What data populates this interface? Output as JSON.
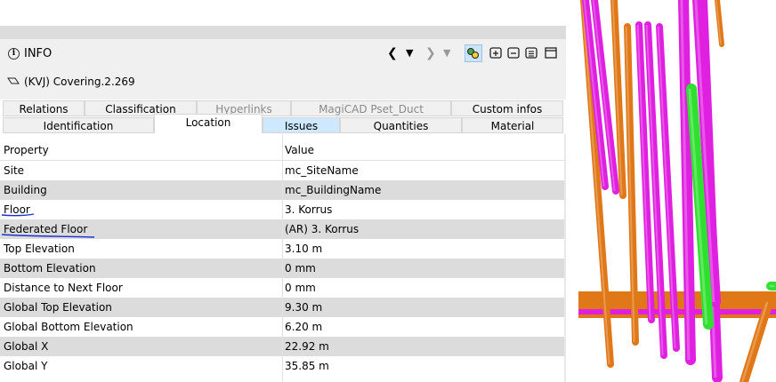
{
  "header": {
    "title": "INFO",
    "object_name": "(KVJ) Covering.2.269",
    "nav": {
      "back": "❮",
      "back_dropdown": "▼",
      "forward": "❯",
      "forward_dropdown": "▼"
    },
    "toolbar_icons": [
      "tree-view-icon",
      "add-panel-icon",
      "remove-panel-icon",
      "list-panel-icon",
      "window-icon"
    ]
  },
  "tabs_row1": [
    {
      "label": "Relations",
      "enabled": true
    },
    {
      "label": "Classification",
      "enabled": true
    },
    {
      "label": "Hyperlinks",
      "enabled": false
    },
    {
      "label": "MagiCAD Pset_Duct",
      "enabled": false
    },
    {
      "label": "Custom infos",
      "enabled": true
    }
  ],
  "tabs_row2": [
    {
      "label": "Identification",
      "active": false
    },
    {
      "label": "Location",
      "active": true
    },
    {
      "label": "Issues",
      "active": false,
      "highlighted": true
    },
    {
      "label": "Quantities",
      "active": false
    },
    {
      "label": "Material",
      "active": false
    }
  ],
  "table": {
    "columns": [
      "Property",
      "Value"
    ],
    "rows": [
      {
        "property": "Site",
        "value": "mc_SiteName"
      },
      {
        "property": "Building",
        "value": "mc_BuildingName"
      },
      {
        "property": "Floor",
        "value": "3. Korrus"
      },
      {
        "property": "Federated Floor",
        "value": "(AR) 3. Korrus"
      },
      {
        "property": "Top Elevation",
        "value": "3.10 m"
      },
      {
        "property": "Bottom Elevation",
        "value": "0 mm"
      },
      {
        "property": "Distance to Next Floor",
        "value": "0 mm"
      },
      {
        "property": "Global Top Elevation",
        "value": "9.30 m"
      },
      {
        "property": "Global Bottom Elevation",
        "value": "6.20 m"
      },
      {
        "property": "Global X",
        "value": "22.92 m"
      },
      {
        "property": "Global Y",
        "value": "35.85 m"
      }
    ]
  },
  "colors": {
    "pipe_magenta": "#e020e0",
    "pipe_orange": "#e07818",
    "pipe_green": "#30e030",
    "annotation_ink": "#1a2fd0",
    "issues_tab_highlight": "#cde8ff"
  }
}
